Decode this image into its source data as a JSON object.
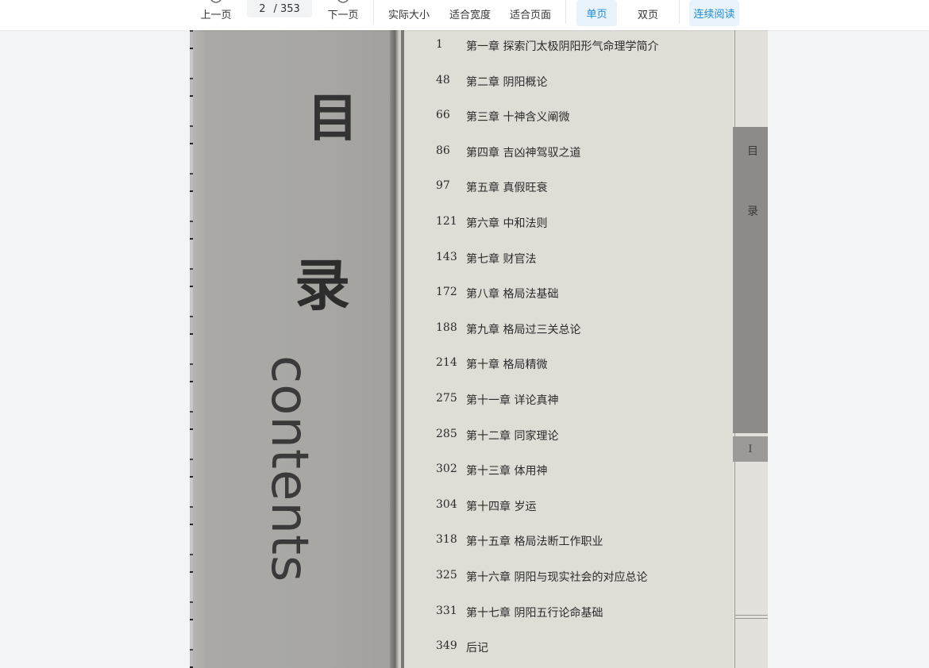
{
  "toolbar": {
    "prev_label": "上一页",
    "page_current": "2",
    "page_total": "/ 353",
    "next_label": "下一页",
    "actual_size_label": "实际大小",
    "fit_width_label": "适合宽度",
    "fit_page_label": "适合页面",
    "single_page_label": "单页",
    "double_page_label": "双页",
    "continuous_label": "连续阅读",
    "accent_color": "#1f8bd6"
  },
  "document": {
    "spine_title_1": "目",
    "spine_title_2": "录",
    "spine_contents": "contents",
    "toc": [
      {
        "page": "1",
        "title": "第一章  探索门太极阴阳形气命理学简介"
      },
      {
        "page": "48",
        "title": "第二章  阴阳概论"
      },
      {
        "page": "66",
        "title": "第三章  十神含义阐微"
      },
      {
        "page": "86",
        "title": "第四章  吉凶神驾驭之道"
      },
      {
        "page": "97",
        "title": "第五章  真假旺衰"
      },
      {
        "page": "121",
        "title": "第六章  中和法则"
      },
      {
        "page": "143",
        "title": "第七章  财官法"
      },
      {
        "page": "172",
        "title": "第八章  格局法基础"
      },
      {
        "page": "188",
        "title": "第九章  格局过三关总论"
      },
      {
        "page": "214",
        "title": "第十章  格局精微"
      },
      {
        "page": "275",
        "title": "第十一章  详论真神"
      },
      {
        "page": "285",
        "title": "第十二章  同家理论"
      },
      {
        "page": "302",
        "title": "第十三章  体用神"
      },
      {
        "page": "304",
        "title": "第十四章  岁运"
      },
      {
        "page": "318",
        "title": "第十五章  格局法断工作职业"
      },
      {
        "page": "325",
        "title": "第十六章  阴阳与现实社会的对应总论"
      },
      {
        "page": "331",
        "title": "第十七章  阴阳五行论命基础"
      },
      {
        "page": "349",
        "title": "后记"
      }
    ],
    "side_tab_1": "目",
    "side_tab_2": "录",
    "side_number": "I"
  }
}
